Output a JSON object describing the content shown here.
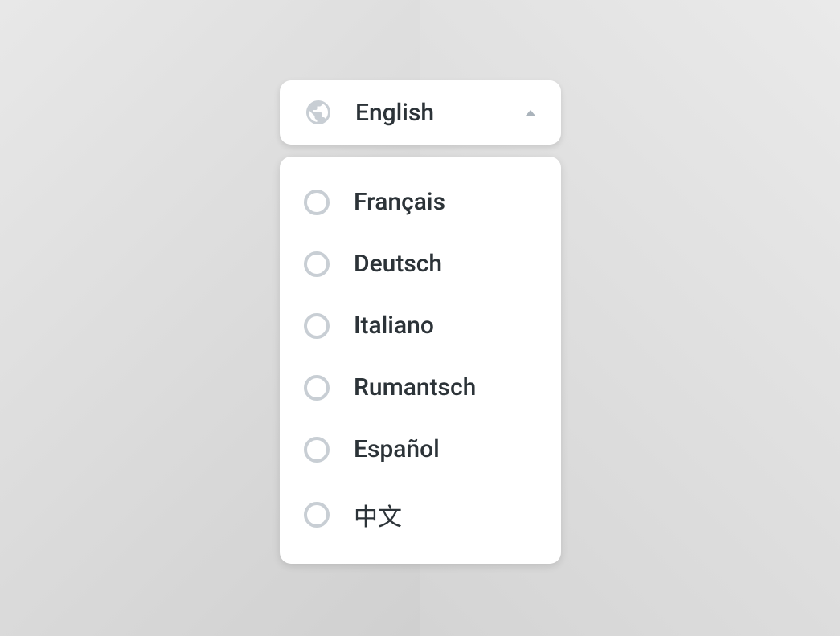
{
  "dropdown": {
    "selected": "English",
    "options": [
      {
        "label": "Français"
      },
      {
        "label": "Deutsch"
      },
      {
        "label": "Italiano"
      },
      {
        "label": "Rumantsch"
      },
      {
        "label": "Español"
      },
      {
        "label": "中文"
      }
    ]
  }
}
